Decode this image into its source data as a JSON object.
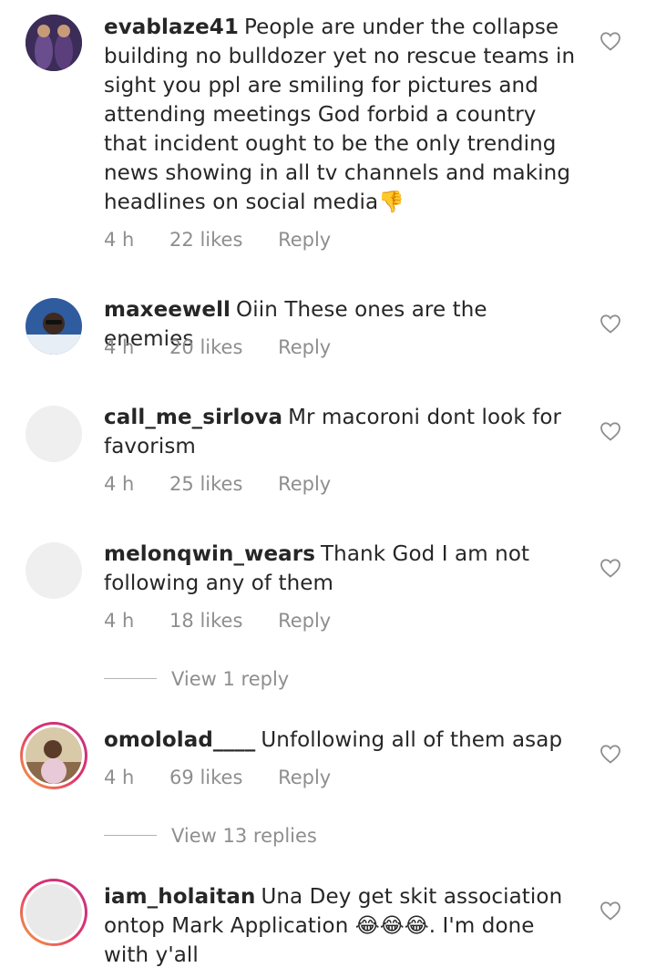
{
  "comments": [
    {
      "username": "evablaze41",
      "text": "People are under the collapse building no bulldozer yet no rescue teams in sight you ppl are smiling for pictures and attending meetings God forbid a country that incident ought to be the only trending news showing in all tv channels and making headlines on social media👎",
      "time": "4 h",
      "likes": "22 likes",
      "reply": "Reply"
    },
    {
      "username": "maxeewell",
      "text": "Oiin These ones are the enemies",
      "time": "4 h",
      "likes": "20 likes",
      "reply": "Reply"
    },
    {
      "username": "call_me_sirlova",
      "text": "Mr macoroni dont look for favorism",
      "time": "4 h",
      "likes": "25 likes",
      "reply": "Reply"
    },
    {
      "username": "melonqwin_wears",
      "text": "Thank God I am not following any of them",
      "time": "4 h",
      "likes": "18 likes",
      "reply": "Reply",
      "view_replies": "View 1 reply"
    },
    {
      "username": "omololad____",
      "text": "Unfollowing all of them asap",
      "time": "4 h",
      "likes": "69 likes",
      "reply": "Reply",
      "view_replies": "View 13 replies"
    },
    {
      "username": "iam_holaitan",
      "text": "Una Dey get skit association ontop Mark Application 😂😂😂. I'm done with y'all"
    }
  ],
  "icons": {
    "like": "heart-outline-icon"
  },
  "colors": {
    "meta_text": "#8e8e8e",
    "story_ring": "#e1306c"
  }
}
